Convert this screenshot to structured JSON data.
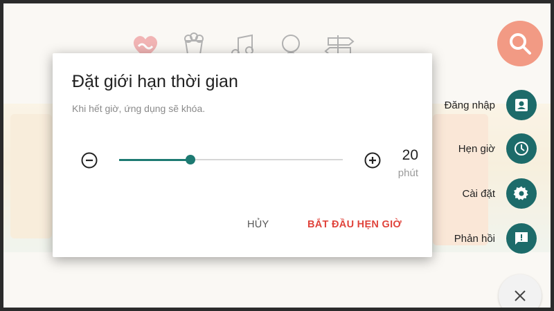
{
  "dialog": {
    "title": "Đặt giới hạn thời gian",
    "message": "Khi hết giờ, ứng dụng sẽ khóa.",
    "timer": {
      "value": "20",
      "unit": "phút",
      "slider_fraction": 0.32
    },
    "cancel_label": "HỦY",
    "start_label": "BẮT ĐẦU HẸN GIỜ"
  },
  "side_menu": {
    "items": [
      {
        "label": "Đăng nhập",
        "icon": "account-box-icon"
      },
      {
        "label": "Hẹn giờ",
        "icon": "clock-icon"
      },
      {
        "label": "Cài đặt",
        "icon": "gear-icon"
      },
      {
        "label": "Phản hồi",
        "icon": "feedback-icon"
      }
    ]
  },
  "colors": {
    "accent": "#1d7a72",
    "fab": "#1d6b6a",
    "start_button": "#e0443c",
    "search_fab": "#f29a84"
  }
}
